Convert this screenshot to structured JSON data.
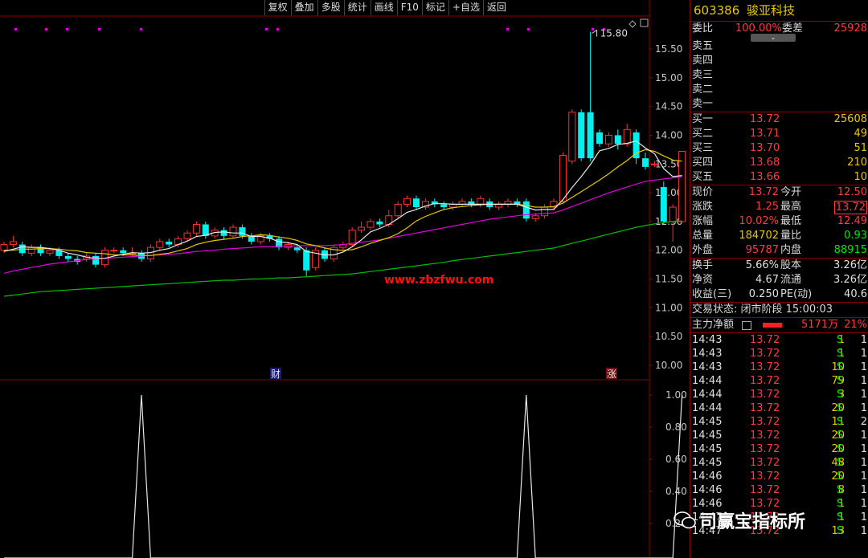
{
  "toolbar": {
    "buttons": [
      "复权",
      "叠加",
      "多股",
      "统计",
      "画线",
      "F10",
      "标记",
      "+自选",
      "返回"
    ]
  },
  "site_watermark": "www.zbzfwu.com",
  "chart": {
    "high_label": "15.80",
    "yaxis_main": [
      "15.50",
      "15.00",
      "14.50",
      "14.00",
      "13.50",
      "13.00",
      "12.50",
      "12.00",
      "11.50",
      "11.00",
      "10.50",
      "10.00"
    ],
    "yaxis_sub": [
      "1.00",
      "0.80",
      "0.60",
      "0.40",
      "0.20"
    ],
    "markers": {
      "cai": "财",
      "zhang": "涨"
    },
    "ticks_main": [
      15.5,
      15.0,
      14.5,
      14.0,
      13.5,
      13.0,
      12.5,
      12.0,
      11.5,
      11.0,
      10.5,
      10.0
    ],
    "ticks_sub": [
      1.0,
      0.8,
      0.6,
      0.4,
      0.2
    ],
    "candles": [
      [
        12.0,
        12.1,
        11.95,
        12.15
      ],
      [
        12.1,
        12.15,
        12.05,
        12.25
      ],
      [
        12.1,
        11.95,
        11.9,
        12.15
      ],
      [
        11.95,
        12.05,
        11.9,
        12.1
      ],
      [
        12.05,
        11.95,
        11.9,
        12.1
      ],
      [
        11.95,
        12.0,
        11.9,
        12.05
      ],
      [
        12.0,
        11.9,
        11.85,
        12.05
      ],
      [
        11.9,
        11.85,
        11.8,
        11.95
      ],
      [
        11.85,
        11.8,
        11.75,
        11.9
      ],
      [
        11.85,
        11.9,
        11.8,
        11.95
      ],
      [
        11.9,
        11.75,
        11.7,
        11.95
      ],
      [
        11.75,
        12.0,
        11.7,
        12.05
      ],
      [
        12.0,
        12.0,
        11.95,
        12.05
      ],
      [
        12.0,
        11.95,
        11.9,
        12.05
      ],
      [
        11.95,
        11.95,
        11.9,
        12.05
      ],
      [
        11.95,
        11.85,
        11.8,
        12.0
      ],
      [
        11.85,
        12.05,
        11.8,
        12.1
      ],
      [
        12.05,
        12.15,
        12.0,
        12.2
      ],
      [
        12.15,
        12.1,
        12.05,
        12.2
      ],
      [
        12.1,
        12.2,
        12.05,
        12.25
      ],
      [
        12.2,
        12.3,
        12.15,
        12.35
      ],
      [
        12.3,
        12.45,
        12.25,
        12.5
      ],
      [
        12.45,
        12.25,
        12.2,
        12.5
      ],
      [
        12.25,
        12.35,
        12.2,
        12.4
      ],
      [
        12.35,
        12.25,
        12.2,
        12.4
      ],
      [
        12.25,
        12.4,
        12.2,
        12.45
      ],
      [
        12.4,
        12.25,
        12.2,
        12.45
      ],
      [
        12.25,
        12.15,
        12.1,
        12.3
      ],
      [
        12.15,
        12.25,
        12.1,
        12.3
      ],
      [
        12.25,
        12.2,
        12.15,
        12.3
      ],
      [
        12.2,
        12.05,
        12.0,
        12.25
      ],
      [
        12.05,
        12.1,
        12.0,
        12.15
      ],
      [
        12.05,
        12.0,
        11.95,
        12.1
      ],
      [
        12.0,
        11.65,
        11.55,
        12.05
      ],
      [
        11.7,
        12.0,
        11.65,
        12.05
      ],
      [
        12.0,
        11.85,
        11.8,
        12.05
      ],
      [
        11.85,
        12.05,
        11.8,
        12.1
      ],
      [
        12.05,
        12.1,
        12.0,
        12.15
      ],
      [
        12.1,
        12.35,
        12.05,
        12.4
      ],
      [
        12.35,
        12.4,
        12.3,
        12.5
      ],
      [
        12.4,
        12.5,
        12.35,
        12.55
      ],
      [
        12.5,
        12.45,
        12.4,
        12.55
      ],
      [
        12.45,
        12.6,
        12.4,
        12.7
      ],
      [
        12.6,
        12.8,
        12.55,
        12.85
      ],
      [
        12.8,
        12.9,
        12.75,
        12.95
      ],
      [
        12.9,
        12.75,
        12.7,
        12.95
      ],
      [
        12.75,
        12.85,
        12.7,
        12.9
      ],
      [
        12.85,
        12.8,
        12.75,
        12.9
      ],
      [
        12.8,
        12.75,
        12.7,
        12.85
      ],
      [
        12.75,
        12.8,
        12.7,
        12.85
      ],
      [
        12.8,
        12.85,
        12.75,
        12.9
      ],
      [
        12.85,
        12.8,
        12.75,
        12.9
      ],
      [
        12.8,
        12.9,
        12.75,
        12.95
      ],
      [
        12.85,
        12.75,
        12.7,
        12.9
      ],
      [
        12.75,
        12.8,
        12.7,
        12.85
      ],
      [
        12.8,
        12.85,
        12.75,
        12.9
      ],
      [
        12.85,
        12.8,
        12.75,
        12.9
      ],
      [
        12.85,
        12.55,
        12.5,
        12.9
      ],
      [
        12.55,
        12.6,
        12.5,
        12.65
      ],
      [
        12.6,
        12.75,
        12.55,
        12.8
      ],
      [
        12.75,
        12.85,
        12.7,
        12.9
      ],
      [
        12.85,
        13.65,
        12.8,
        13.7
      ],
      [
        13.55,
        14.4,
        13.5,
        14.45
      ],
      [
        14.4,
        13.6,
        13.55,
        14.45
      ],
      [
        14.4,
        13.6,
        13.55,
        15.8
      ],
      [
        14.05,
        13.85,
        13.8,
        14.1
      ],
      [
        13.85,
        14.0,
        13.8,
        14.05
      ],
      [
        14.0,
        13.85,
        13.75,
        14.1
      ],
      [
        13.85,
        14.1,
        13.8,
        14.2
      ],
      [
        14.05,
        13.6,
        13.5,
        14.1
      ],
      [
        13.6,
        13.45,
        13.4,
        13.7
      ],
      [
        13.5,
        13.5,
        13.45,
        13.55
      ],
      [
        13.1,
        12.5,
        12.45,
        13.2
      ],
      [
        12.5,
        12.75,
        12.15,
        12.8
      ],
      [
        12.5,
        13.72,
        12.49,
        13.72
      ]
    ],
    "ma5": [
      11.98,
      12.02,
      12.06,
      12.05,
      12.05,
      12.03,
      12.0,
      11.95,
      11.92,
      11.88,
      11.86,
      11.86,
      11.9,
      11.93,
      11.96,
      11.95,
      11.96,
      12.0,
      12.03,
      12.1,
      12.16,
      12.24,
      12.26,
      12.31,
      12.32,
      12.3,
      12.3,
      12.24,
      12.24,
      12.21,
      12.15,
      12.13,
      12.1,
      11.98,
      11.95,
      11.92,
      11.92,
      11.97,
      12.06,
      12.18,
      12.32,
      12.38,
      12.45,
      12.55,
      12.66,
      12.71,
      12.77,
      12.81,
      12.81,
      12.8,
      12.8,
      12.8,
      12.8,
      12.8,
      12.8,
      12.8,
      12.8,
      12.75,
      12.7,
      12.71,
      12.71,
      12.88,
      13.09,
      13.28,
      13.49,
      13.73,
      13.77,
      13.84,
      13.86,
      13.9,
      13.78,
      13.68,
      13.42,
      13.28,
      13.3
    ],
    "ma10": [
      12.0,
      12.0,
      12.02,
      12.02,
      12.03,
      12.03,
      12.02,
      12.0,
      11.99,
      11.96,
      11.95,
      11.94,
      11.92,
      11.92,
      11.92,
      11.91,
      11.91,
      11.93,
      11.95,
      11.99,
      12.03,
      12.1,
      12.14,
      12.17,
      12.19,
      12.21,
      12.24,
      12.25,
      12.27,
      12.26,
      12.23,
      12.21,
      12.17,
      12.11,
      12.08,
      12.04,
      12.01,
      12.0,
      12.01,
      12.06,
      12.12,
      12.17,
      12.22,
      12.29,
      12.39,
      12.51,
      12.59,
      12.65,
      12.71,
      12.74,
      12.76,
      12.78,
      12.79,
      12.8,
      12.8,
      12.8,
      12.8,
      12.78,
      12.75,
      12.75,
      12.76,
      12.82,
      12.92,
      13.02,
      13.12,
      13.22,
      13.33,
      13.45,
      13.56,
      13.69,
      13.75,
      13.72,
      13.64,
      13.57,
      13.55
    ],
    "ma30": [
      11.6,
      11.64,
      11.67,
      11.7,
      11.73,
      11.76,
      11.78,
      11.8,
      11.82,
      11.84,
      11.85,
      11.86,
      11.87,
      11.88,
      11.89,
      11.9,
      11.91,
      11.92,
      11.93,
      11.94,
      11.96,
      11.98,
      11.99,
      12.0,
      12.02,
      12.03,
      12.04,
      12.05,
      12.06,
      12.06,
      12.07,
      12.07,
      12.08,
      12.08,
      12.08,
      12.08,
      12.09,
      12.1,
      12.12,
      12.14,
      12.16,
      12.18,
      12.21,
      12.24,
      12.27,
      12.3,
      12.33,
      12.36,
      12.39,
      12.42,
      12.45,
      12.48,
      12.51,
      12.54,
      12.56,
      12.58,
      12.6,
      12.62,
      12.63,
      12.64,
      12.65,
      12.7,
      12.76,
      12.82,
      12.88,
      12.94,
      13.0,
      13.05,
      13.1,
      13.15,
      13.2,
      13.22,
      13.24,
      13.26,
      13.28
    ],
    "ma60": [
      11.2,
      11.22,
      11.24,
      11.26,
      11.28,
      11.29,
      11.3,
      11.31,
      11.32,
      11.33,
      11.34,
      11.35,
      11.36,
      11.37,
      11.38,
      11.39,
      11.4,
      11.41,
      11.42,
      11.43,
      11.44,
      11.45,
      11.46,
      11.47,
      11.48,
      11.48,
      11.49,
      11.5,
      11.5,
      11.51,
      11.52,
      11.52,
      11.53,
      11.54,
      11.55,
      11.56,
      11.57,
      11.58,
      11.59,
      11.61,
      11.63,
      11.65,
      11.67,
      11.69,
      11.71,
      11.73,
      11.75,
      11.77,
      11.79,
      11.82,
      11.84,
      11.86,
      11.88,
      11.9,
      11.92,
      11.94,
      11.96,
      11.98,
      12.0,
      12.02,
      12.04,
      12.08,
      12.12,
      12.16,
      12.2,
      12.24,
      12.28,
      12.32,
      12.36,
      12.4,
      12.43,
      12.46,
      12.48,
      12.5,
      12.51
    ],
    "signal": [
      0,
      0,
      0,
      0,
      0,
      0,
      0,
      0,
      0,
      0,
      0,
      0,
      0,
      0,
      0,
      1,
      0,
      0,
      0,
      0,
      0,
      0,
      0,
      0,
      0,
      0,
      0,
      0,
      0,
      0,
      0,
      0,
      0,
      0,
      0,
      0,
      0,
      0,
      0,
      0,
      0,
      0,
      0,
      0,
      0,
      0,
      0,
      0,
      0,
      0,
      0,
      0,
      0,
      0,
      0,
      0,
      0,
      1,
      0,
      0,
      0,
      0,
      0,
      0,
      0,
      0,
      0,
      0,
      0,
      0,
      0,
      0,
      0,
      0,
      1
    ]
  },
  "quote": {
    "code": "603386",
    "name": "骏亚科技",
    "weibi_label": "委比",
    "weibi": "100.00%",
    "weicha_label": "委差",
    "weicha": "25928",
    "sells": [
      {
        "label": "卖五"
      },
      {
        "label": "卖四"
      },
      {
        "label": "卖三"
      },
      {
        "label": "卖二"
      },
      {
        "label": "卖一"
      }
    ],
    "buys": [
      {
        "label": "买一",
        "price": "13.72",
        "vol": "25608"
      },
      {
        "label": "买二",
        "price": "13.71",
        "vol": "49"
      },
      {
        "label": "买三",
        "price": "13.70",
        "vol": "51"
      },
      {
        "label": "买四",
        "price": "13.68",
        "vol": "210"
      },
      {
        "label": "买五",
        "price": "13.66",
        "vol": "10"
      }
    ],
    "stats": [
      {
        "l1": "现价",
        "v1": "13.72",
        "l2": "今开",
        "v2": "12.50"
      },
      {
        "l1": "涨跌",
        "v1": "1.25",
        "l2": "最高",
        "v2": "13.72"
      },
      {
        "l1": "涨幅",
        "v1": "10.02%",
        "l2": "最低",
        "v2": "12.49"
      },
      {
        "l1": "总量",
        "v1": "184702",
        "l2": "量比",
        "v2": "0.93"
      },
      {
        "l1": "外盘",
        "v1": "95787",
        "l2": "内盘",
        "v2": "88915"
      }
    ],
    "stats2": [
      {
        "l1": "换手",
        "v1": "5.66%",
        "l2": "股本",
        "v2": "3.26亿"
      },
      {
        "l1": "净资",
        "v1": "4.67",
        "l2": "流通",
        "v2": "3.26亿"
      },
      {
        "l1": "收益(三)",
        "v1": "0.250",
        "l2": "PE(动)",
        "v2": "40.6"
      }
    ],
    "trade_status": "交易状态: 闭市阶段 15:00:03",
    "main_net_label": "主力净额",
    "main_net": "5171万",
    "main_net_pct": "21%",
    "ticks": [
      {
        "t": "14:43",
        "p": "13.72",
        "v": "1",
        "s": "S",
        "n": "1"
      },
      {
        "t": "14:43",
        "p": "13.72",
        "v": "1",
        "s": "S",
        "n": "1"
      },
      {
        "t": "14:43",
        "p": "13.72",
        "v": "10",
        "s": "S",
        "n": "1"
      },
      {
        "t": "14:44",
        "p": "13.72",
        "v": "79",
        "s": "S",
        "n": "1"
      },
      {
        "t": "14:44",
        "p": "13.72",
        "v": "3",
        "s": "S",
        "n": "1"
      },
      {
        "t": "14:44",
        "p": "13.72",
        "v": "20",
        "s": "S",
        "n": "1"
      },
      {
        "t": "14:45",
        "p": "13.72",
        "v": "11",
        "s": "S",
        "n": "2"
      },
      {
        "t": "14:45",
        "p": "13.72",
        "v": "20",
        "s": "S",
        "n": "1"
      },
      {
        "t": "14:45",
        "p": "13.72",
        "v": "20",
        "s": "S",
        "n": "1"
      },
      {
        "t": "14:45",
        "p": "13.72",
        "v": "48",
        "s": "S",
        "n": "1"
      },
      {
        "t": "14:46",
        "p": "13.72",
        "v": "20",
        "s": "S",
        "n": "1"
      },
      {
        "t": "14:46",
        "p": "13.72",
        "v": "8",
        "s": "S",
        "n": "1"
      },
      {
        "t": "14:46",
        "p": "13.72",
        "v": "1",
        "s": "S",
        "n": "1"
      },
      {
        "t": "14:47",
        "p": "13.72",
        "v": "1",
        "s": "S",
        "n": "1"
      },
      {
        "t": "14:47",
        "p": "13.72",
        "v": "13",
        "s": "S",
        "n": "1"
      }
    ]
  },
  "brand_watermark": "司赢宝指标所"
}
